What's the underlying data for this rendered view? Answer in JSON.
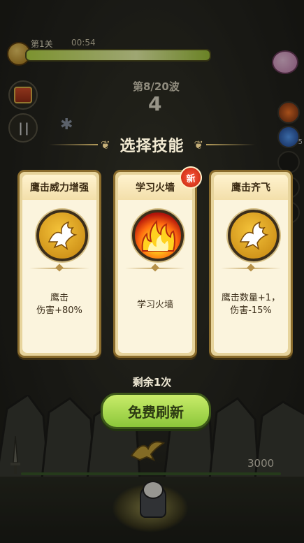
{
  "hud": {
    "level": "第1关",
    "timer": "00:54",
    "wave_label": "第8/20波",
    "wave_count": "4",
    "progress": 1.0,
    "slot_count": "5"
  },
  "dialog": {
    "title": "选择技能",
    "cards": [
      {
        "name": "鹰击威力增强",
        "desc_line1": "鹰击",
        "desc_line2": "伤害+80%",
        "icon": "eagle-icon"
      },
      {
        "name": "学习火墙",
        "desc_line1": "学习火墙",
        "desc_line2": "",
        "icon": "fire-wall-icon",
        "badge": "新"
      },
      {
        "name": "鹰击齐飞",
        "desc_line1": "鹰击数量+1，",
        "desc_line2": "伤害-15%",
        "icon": "eagle-icon"
      }
    ],
    "remaining": "剩余1次",
    "refresh_label": "免费刷新"
  },
  "battle": {
    "hp_value": "3000"
  },
  "colors": {
    "accent_green": "#a6d84a",
    "card_bg": "#fbf4dd",
    "card_border": "#8a6c2d",
    "badge_red": "#e0341a"
  }
}
